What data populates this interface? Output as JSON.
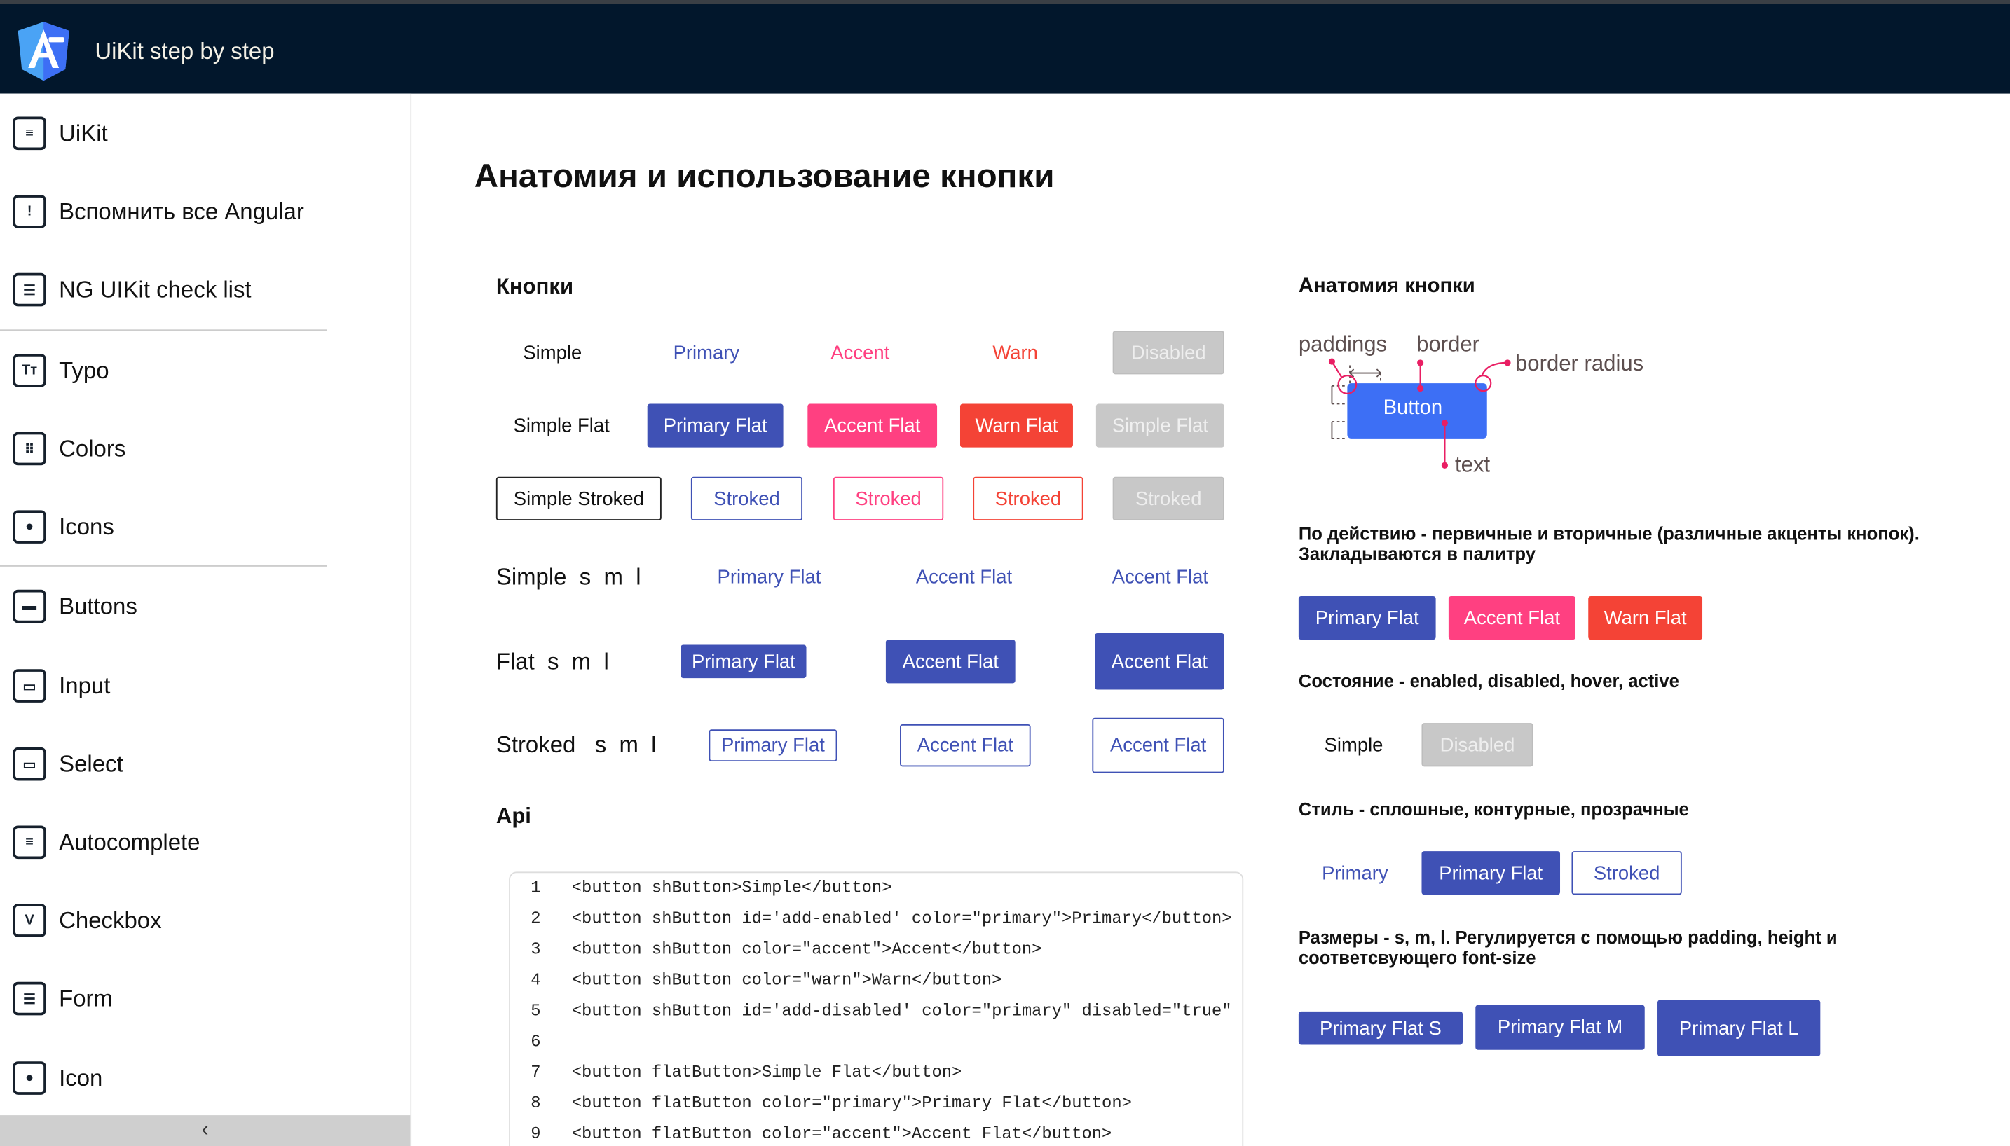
{
  "app": {
    "title": "UiKit step by step",
    "logo_icon": "angular-uikit-logo"
  },
  "sidebar": {
    "items": [
      {
        "label": "UiKit",
        "icon": "list-icon"
      },
      {
        "label": "Вспомнить все Angular",
        "icon": "alert-message-icon"
      },
      {
        "label": "NG UIKit check list",
        "icon": "checklist-icon"
      },
      {
        "label": "Typo",
        "icon": "typography-icon"
      },
      {
        "label": "Colors",
        "icon": "palette-grid-icon"
      },
      {
        "label": "Icons",
        "icon": "blob-icon"
      },
      {
        "label": "Buttons",
        "icon": "buttons-icon"
      },
      {
        "label": "Input",
        "icon": "input-icon"
      },
      {
        "label": "Select",
        "icon": "select-icon"
      },
      {
        "label": "Autocomplete",
        "icon": "autocomplete-icon"
      },
      {
        "label": "Checkbox",
        "icon": "checkbox-icon"
      },
      {
        "label": "Form",
        "icon": "form-icon"
      },
      {
        "label": "Icon",
        "icon": "blob-icon"
      }
    ],
    "collapse_icon": "chevron-left-icon"
  },
  "main": {
    "title": "Анатомия и использование кнопки",
    "buttons_heading": "Кнопки",
    "row1": [
      "Simple",
      "Primary",
      "Accent",
      "Warn",
      "Disabled"
    ],
    "row2": [
      "Simple Flat",
      "Primary Flat",
      "Accent Flat",
      "Warn Flat",
      "Simple Flat"
    ],
    "row3": [
      "Simple Stroked",
      "Stroked",
      "Stroked",
      "Stroked",
      "Stroked"
    ],
    "row4": {
      "label": "Simple  s  m  l",
      "buttons": [
        "Primary Flat",
        "Accent Flat",
        "Accent Flat"
      ]
    },
    "row5": {
      "label": "Flat  s  m  l",
      "buttons": [
        "Primary Flat",
        "Accent Flat",
        "Accent Flat"
      ]
    },
    "row6": {
      "label": "Stroked   s  m  l",
      "buttons": [
        "Primary Flat",
        "Accent Flat",
        "Accent Flat"
      ]
    },
    "api_heading": "Api",
    "code": [
      {
        "n": "1",
        "c": "<button shButton>Simple</button>"
      },
      {
        "n": "2",
        "c": "<button shButton id='add-enabled' color=\"primary\">Primary</button>"
      },
      {
        "n": "3",
        "c": "<button shButton color=\"accent\">Accent</button>"
      },
      {
        "n": "4",
        "c": "<button shButton color=\"warn\">Warn</button>"
      },
      {
        "n": "5",
        "c": "<button shButton id='add-disabled' color=\"primary\" disabled=\"true\""
      },
      {
        "n": "6",
        "c": ""
      },
      {
        "n": "7",
        "c": "<button flatButton>Simple Flat</button>"
      },
      {
        "n": "8",
        "c": "<button flatButton color=\"primary\">Primary Flat</button>"
      },
      {
        "n": "9",
        "c": "<button flatButton color=\"accent\">Accent Flat</button>"
      }
    ]
  },
  "anatomy": {
    "heading": "Анатомия кнопки",
    "labels": {
      "paddings": "paddings",
      "border": "border",
      "border_radius": "border radius",
      "button": "Button",
      "text": "text"
    },
    "action_text_1": "По действию - первичные и вторичные (различные акценты кнопок).",
    "action_text_2": "Закладываются в палитру",
    "action_buttons": [
      "Primary Flat",
      "Accent Flat",
      "Warn Flat"
    ],
    "state_text": "Состояние - enabled, disabled, hover, active",
    "state_buttons": [
      "Simple",
      "Disabled"
    ],
    "style_text": "Стиль - сплошные, контурные, прозрачные",
    "style_buttons": [
      "Primary",
      "Primary Flat",
      "Stroked"
    ],
    "size_text_1": "Размеры - s, m, l. Регулируется с помощью padding, height и",
    "size_text_2": "соответсвующего font-size",
    "size_buttons": [
      "Primary Flat S",
      "Primary Flat M",
      "Primary Flat L"
    ]
  },
  "colors": {
    "primary": "#3f51b5",
    "accent": "#ff4081",
    "warn": "#f44336",
    "disabled": "#c8c8c8",
    "header": "#02172c",
    "diagram_button": "#3d6ff5",
    "diagram_marker": "#e91e63"
  }
}
